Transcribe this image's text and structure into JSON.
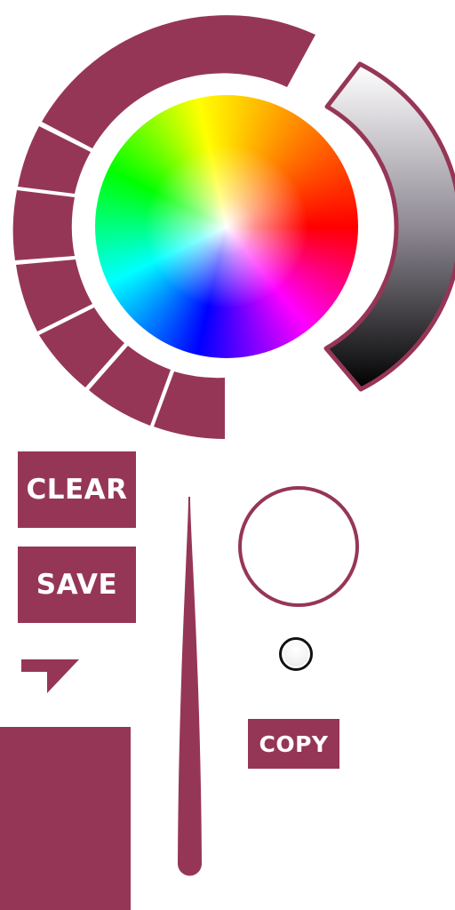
{
  "buttons": {
    "clear_label": "CLEAR",
    "save_label": "SAVE",
    "copy_label": "COPY"
  },
  "theme": {
    "accent": "#963656",
    "background": "#ffffff"
  },
  "icons": {
    "color_wheel": "color-wheel",
    "brightness_slider": "brightness-gradient-slider",
    "brush_size": "brush-size-taper",
    "dropdown": "dropdown-corner-icon"
  }
}
